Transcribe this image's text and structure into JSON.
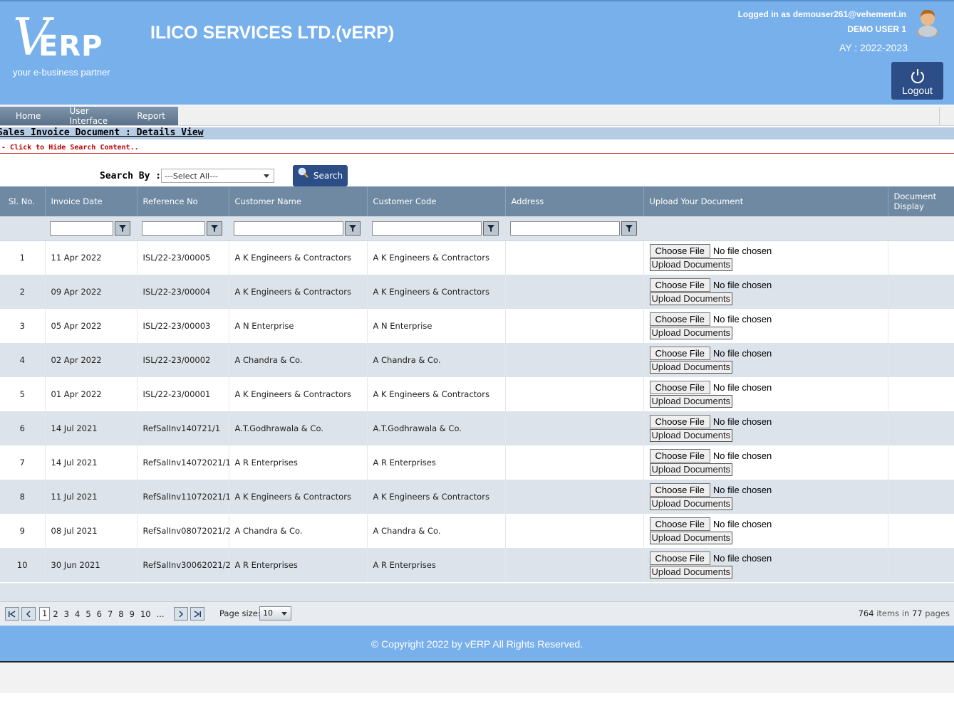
{
  "header": {
    "logo_mark": "V",
    "logo_text": "ERP",
    "logo_tagline": "your e-business partner",
    "company": "ILICO SERVICES LTD.(vERP)",
    "logged_in": "Logged in as demouser261@vehement.in",
    "user_name": "DEMO USER 1",
    "ay": "AY : 2022-2023",
    "logout_label": "Logout"
  },
  "menu": [
    "Home",
    "User Interface",
    "Report"
  ],
  "page": {
    "title": "Sales Invoice Document : Details View",
    "hide_link": "- Click to Hide Search Content..",
    "search_by_label": "Search By :",
    "search_select": "---Select All---",
    "search_button": "Search"
  },
  "columns": [
    "Sl. No.",
    "Invoice Date",
    "Reference No",
    "Customer Name",
    "Customer Code",
    "Address",
    "Upload Your Document",
    "Document Display"
  ],
  "file_labels": {
    "choose": "Choose File",
    "none": "No file chosen",
    "upload": "Upload Documents"
  },
  "rows": [
    {
      "sl": "1",
      "date": "11 Apr 2022",
      "ref": "ISL/22-23/00005",
      "name": "A K Engineers & Contractors",
      "code": "A K Engineers & Contractors"
    },
    {
      "sl": "2",
      "date": "09 Apr 2022",
      "ref": "ISL/22-23/00004",
      "name": "A K Engineers & Contractors",
      "code": "A K Engineers & Contractors"
    },
    {
      "sl": "3",
      "date": "05 Apr 2022",
      "ref": "ISL/22-23/00003",
      "name": "A N Enterprise",
      "code": "A N Enterprise"
    },
    {
      "sl": "4",
      "date": "02 Apr 2022",
      "ref": "ISL/22-23/00002",
      "name": "A Chandra & Co.",
      "code": "A Chandra & Co."
    },
    {
      "sl": "5",
      "date": "01 Apr 2022",
      "ref": "ISL/22-23/00001",
      "name": "A K Engineers & Contractors",
      "code": "A K Engineers & Contractors"
    },
    {
      "sl": "6",
      "date": "14 Jul 2021",
      "ref": "RefSalInv140721/1",
      "name": "A.T.Godhrawala & Co.",
      "code": "A.T.Godhrawala & Co."
    },
    {
      "sl": "7",
      "date": "14 Jul 2021",
      "ref": "RefSalInv14072021/1",
      "name": "A R Enterprises",
      "code": "A R Enterprises"
    },
    {
      "sl": "8",
      "date": "11 Jul 2021",
      "ref": "RefSalInv11072021/1",
      "name": "A K Engineers & Contractors",
      "code": "A K Engineers & Contractors"
    },
    {
      "sl": "9",
      "date": "08 Jul 2021",
      "ref": "RefSalInv08072021/2",
      "name": "A Chandra & Co.",
      "code": "A Chandra & Co."
    },
    {
      "sl": "10",
      "date": "30 Jun 2021",
      "ref": "RefSalInv30062021/2",
      "name": "A R Enterprises",
      "code": "A R Enterprises"
    }
  ],
  "pager": {
    "pages": [
      "1",
      "2",
      "3",
      "4",
      "5",
      "6",
      "7",
      "8",
      "9",
      "10",
      "..."
    ],
    "current": "1",
    "page_size_label": "Page size:",
    "page_size": "10",
    "items": "764",
    "items_label": "items in",
    "pages_count": "77",
    "pages_label": "pages"
  },
  "footer": {
    "copyright": "© Copyright 2022 by vERP All Rights Reserved."
  }
}
